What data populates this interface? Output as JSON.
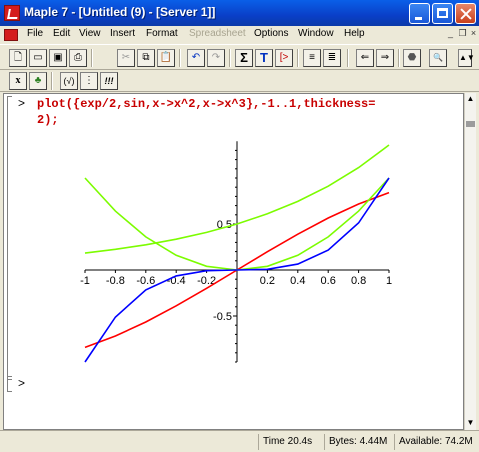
{
  "window": {
    "title": "Maple 7 - [Untitled (9) - [Server 1]]"
  },
  "menu": {
    "items": [
      {
        "label": "File",
        "enabled": true
      },
      {
        "label": "Edit",
        "enabled": true
      },
      {
        "label": "View",
        "enabled": true
      },
      {
        "label": "Insert",
        "enabled": true
      },
      {
        "label": "Format",
        "enabled": true
      },
      {
        "label": "Spreadsheet",
        "enabled": false
      },
      {
        "label": "Options",
        "enabled": true
      },
      {
        "label": "Window",
        "enabled": true
      },
      {
        "label": "Help",
        "enabled": true
      }
    ]
  },
  "toolbar": {
    "buttons": [
      "new-icon",
      "open-icon",
      "save-icon",
      "print-icon",
      "cut-icon",
      "copy-icon",
      "paste-icon",
      "undo-icon",
      "redo-icon",
      "sigma-icon",
      "text-T-icon",
      "prompt-icon",
      "indent-icon",
      "outdent-icon",
      "back-icon",
      "forward-icon",
      "stop-icon",
      "zoom-icon",
      "restart-icon"
    ],
    "sigma_glyph": "Σ",
    "text_glyph": "T",
    "prompt_glyph": "[>"
  },
  "context_toolbar": {
    "x_label": "x",
    "leaf_glyph": "♣",
    "sqrt_label": "(√)",
    "colon_label": "⋮",
    "exec_label": "!!!"
  },
  "worksheet": {
    "prompt_symbol": ">",
    "command_line1": "plot({exp/2,sin,x->x^2,x->x^3},-1..1,thickness=",
    "command_line2": "2);",
    "empty_prompt": ">"
  },
  "chart_data": {
    "type": "line",
    "title": "",
    "xlabel": "",
    "ylabel": "",
    "xlim": [
      -1,
      1
    ],
    "ylim": [
      -1,
      1.4
    ],
    "x_ticks": [
      "-1",
      "-0.8",
      "-0.6",
      "-0.4",
      "-0.2",
      "0.2",
      "0.4",
      "0.6",
      "0.8",
      "1"
    ],
    "y_ticks": [
      "0.5",
      "-0.5"
    ],
    "series": [
      {
        "color": "#7cfc00",
        "x": [
          -1,
          -0.8,
          -0.6,
          -0.4,
          -0.2,
          0,
          0.2,
          0.4,
          0.6,
          0.8,
          1
        ],
        "y": [
          0.184,
          0.225,
          0.274,
          0.335,
          0.409,
          0.5,
          0.611,
          0.746,
          0.911,
          1.113,
          1.359
        ]
      },
      {
        "color": "#ff0000",
        "x": [
          -1,
          -0.8,
          -0.6,
          -0.4,
          -0.2,
          0,
          0.2,
          0.4,
          0.6,
          0.8,
          1
        ],
        "y": [
          -0.841,
          -0.717,
          -0.565,
          -0.389,
          -0.199,
          0,
          0.199,
          0.389,
          0.565,
          0.717,
          0.841
        ]
      },
      {
        "color": "#7cfc00",
        "x": [
          -1,
          -0.8,
          -0.6,
          -0.4,
          -0.2,
          0,
          0.2,
          0.4,
          0.6,
          0.8,
          1
        ],
        "y": [
          1,
          0.64,
          0.36,
          0.16,
          0.04,
          0,
          0.04,
          0.16,
          0.36,
          0.64,
          1
        ]
      },
      {
        "color": "#0000ff",
        "x": [
          -1,
          -0.8,
          -0.6,
          -0.4,
          -0.2,
          0,
          0.2,
          0.4,
          0.6,
          0.8,
          1
        ],
        "y": [
          -1,
          -0.512,
          -0.216,
          -0.064,
          -0.008,
          0,
          0.008,
          0.064,
          0.216,
          0.512,
          1
        ]
      }
    ]
  },
  "status": {
    "time_label": "Time",
    "time_value": "20.4s",
    "bytes_label": "Bytes:",
    "bytes_value": "4.44M",
    "available_label": "Available:",
    "available_value": "74.2M"
  }
}
